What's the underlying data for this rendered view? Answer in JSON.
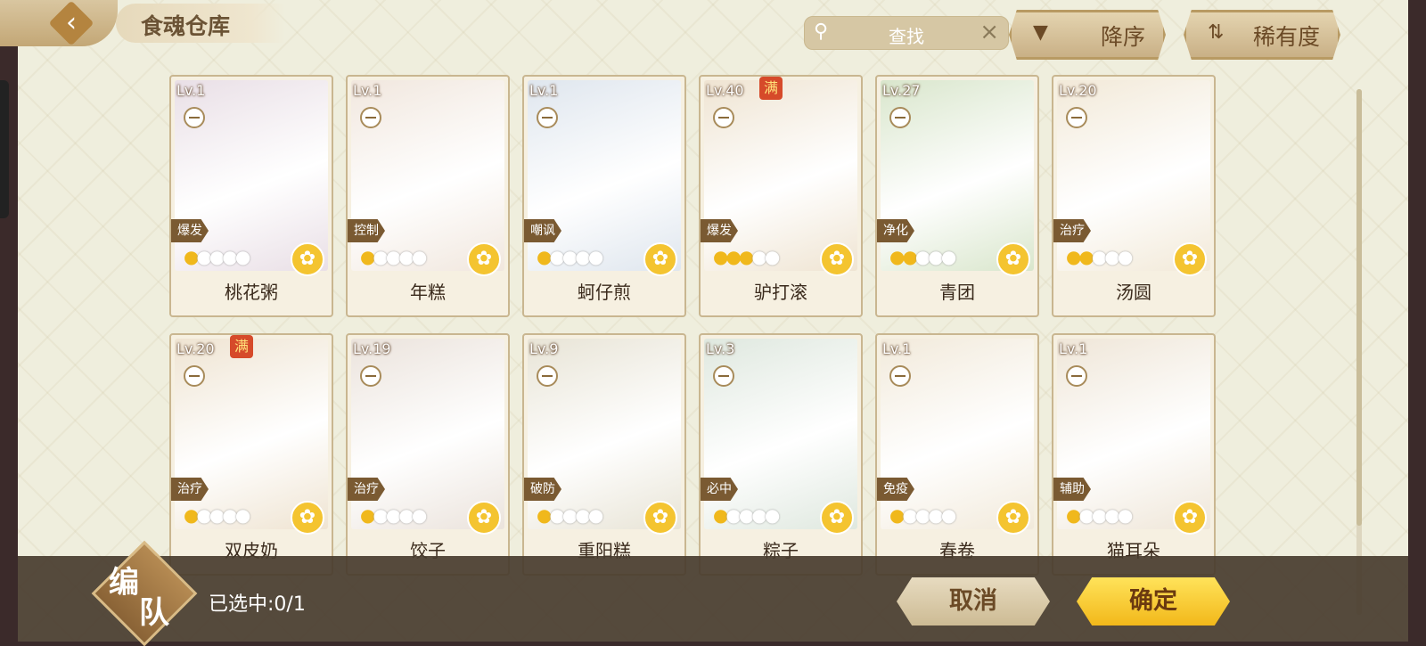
{
  "header": {
    "title": "食魂仓库",
    "search_placeholder": "查找",
    "sort_button": "降序",
    "filter_button": "稀有度"
  },
  "cards": [
    {
      "level": "Lv.1",
      "role": "爆发",
      "name": "桃花粥",
      "stars_on": 1,
      "full": false,
      "bg": "#e9dfe6"
    },
    {
      "level": "Lv.1",
      "role": "控制",
      "name": "年糕",
      "stars_on": 1,
      "full": false,
      "bg": "#f1e7de"
    },
    {
      "level": "Lv.1",
      "role": "嘲讽",
      "name": "蚵仔煎",
      "stars_on": 1,
      "full": false,
      "bg": "#dfe6ee"
    },
    {
      "level": "Lv.40",
      "role": "爆发",
      "name": "驴打滚",
      "stars_on": 3,
      "full": true,
      "full_label": "满",
      "bg": "#efe4d2"
    },
    {
      "level": "Lv.27",
      "role": "净化",
      "name": "青团",
      "stars_on": 2,
      "full": false,
      "bg": "#d9e6cc"
    },
    {
      "level": "Lv.20",
      "role": "治疗",
      "name": "汤圆",
      "stars_on": 2,
      "full": false,
      "bg": "#f2e9d8"
    },
    {
      "level": "Lv.20",
      "role": "治疗",
      "name": "双皮奶",
      "stars_on": 1,
      "full": true,
      "full_label": "满",
      "bg": "#efe4d2"
    },
    {
      "level": "Lv.19",
      "role": "治疗",
      "name": "饺子",
      "stars_on": 1,
      "full": false,
      "bg": "#ebe3dc"
    },
    {
      "level": "Lv.9",
      "role": "破防",
      "name": "重阳糕",
      "stars_on": 1,
      "full": false,
      "bg": "#e8e4d6"
    },
    {
      "level": "Lv.3",
      "role": "必中",
      "name": "粽子",
      "stars_on": 1,
      "full": false,
      "bg": "#dfe8df"
    },
    {
      "level": "Lv.1",
      "role": "免疫",
      "name": "春卷",
      "stars_on": 1,
      "full": false,
      "bg": "#f2eadb"
    },
    {
      "level": "Lv.1",
      "role": "辅助",
      "name": "猫耳朵",
      "stars_on": 1,
      "full": false,
      "bg": "#efe6d8"
    }
  ],
  "footer": {
    "team_char1": "编",
    "team_char2": "队",
    "selected_text": "已选中:0/1",
    "cancel_button": "取消",
    "confirm_button": "确定"
  },
  "colors": {
    "accent": "#f2b81a",
    "brand": "#8a6336",
    "card_border": "#c9b690"
  }
}
